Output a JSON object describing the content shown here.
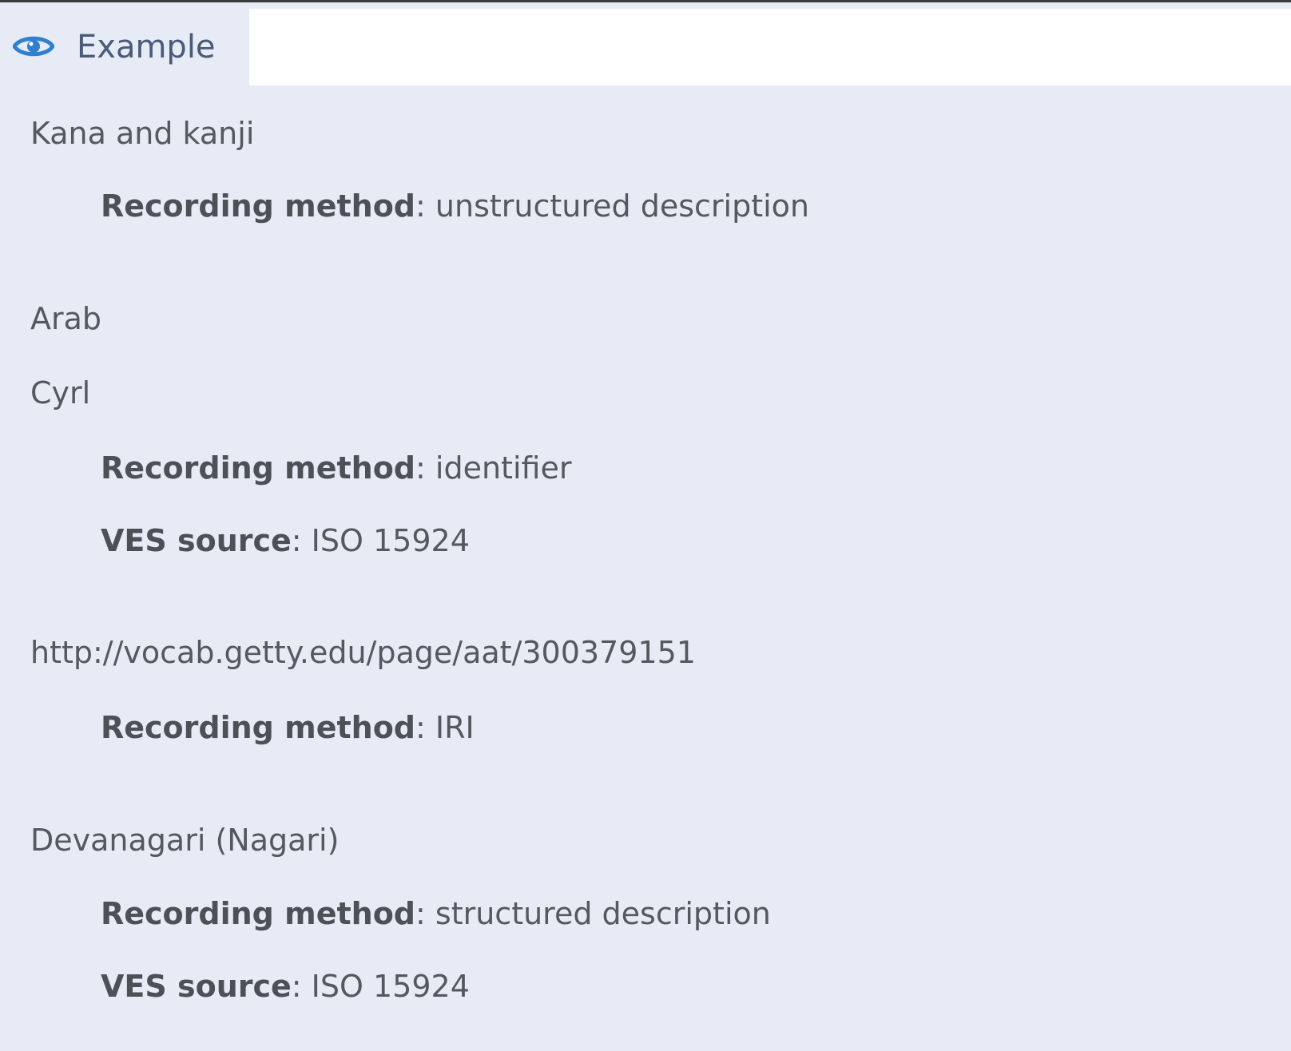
{
  "tab": {
    "label": "Example",
    "icon": "eye-icon",
    "accent": "#2f7fd0"
  },
  "entries": [
    {
      "value": "Kana and kanji",
      "props": [
        {
          "key": "Recording method",
          "sep": ": ",
          "value": "unstructured description"
        }
      ]
    },
    {
      "value": "Arab",
      "props": []
    },
    {
      "value": "Cyrl",
      "props": [
        {
          "key": "Recording method",
          "sep": ": ",
          "value": "identifier"
        },
        {
          "key": "VES source",
          "sep": ": ",
          "value": "ISO 15924"
        }
      ]
    },
    {
      "value": "http://vocab.getty.edu/page/aat/300379151",
      "props": [
        {
          "key": "Recording method",
          "sep": ": ",
          "value": "IRI"
        }
      ]
    },
    {
      "value": "Devanagari (Nagari)",
      "props": [
        {
          "key": "Recording method",
          "sep": ": ",
          "value": "structured description"
        },
        {
          "key": "VES source",
          "sep": ": ",
          "value": "ISO 15924"
        }
      ]
    }
  ]
}
